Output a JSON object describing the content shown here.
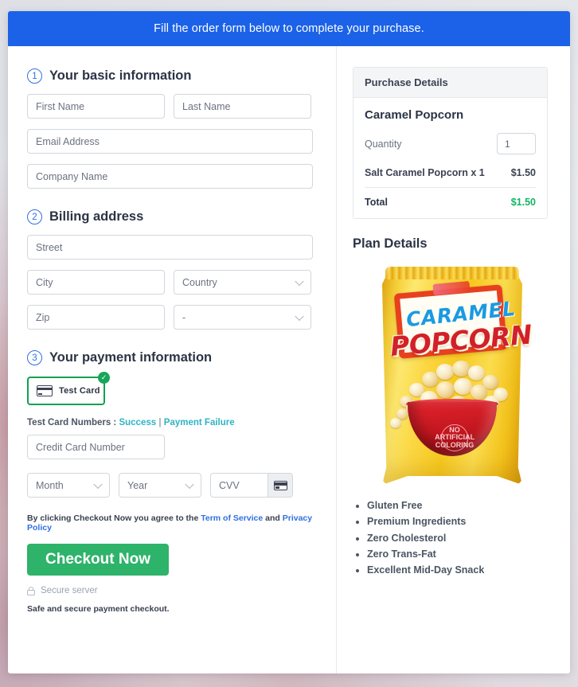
{
  "banner": {
    "text": "Fill the order form below to complete your purchase."
  },
  "steps": {
    "one": {
      "num": "1",
      "title": "Your basic information"
    },
    "two": {
      "num": "2",
      "title": "Billing address"
    },
    "three": {
      "num": "3",
      "title": "Your payment information"
    }
  },
  "basic": {
    "first_name_placeholder": "First Name",
    "last_name_placeholder": "Last Name",
    "email_placeholder": "Email Address",
    "company_placeholder": "Company Name"
  },
  "billing": {
    "street_placeholder": "Street",
    "city_placeholder": "City",
    "country_placeholder": "Country",
    "zip_placeholder": "Zip",
    "state_placeholder": "-"
  },
  "payment": {
    "test_card_label": "Test Card",
    "selected_badge": "✓",
    "test_numbers_label": "Test Card Numbers :",
    "success_link": "Success",
    "separator": "|",
    "failure_link": "Payment Failure",
    "card_number_placeholder": "Credit Card Number",
    "month_placeholder": "Month",
    "year_placeholder": "Year",
    "cvv_placeholder": "CVV"
  },
  "terms": {
    "prefix": "By clicking Checkout Now you agree to the",
    "tos_link": "Term of Service",
    "and": "and",
    "privacy_link": "Privacy Policy"
  },
  "checkout": {
    "button_label": "Checkout Now",
    "secure_label": "Secure server",
    "safe_note": "Safe and secure payment checkout."
  },
  "purchase": {
    "panel_title": "Purchase Details",
    "product_name": "Caramel Popcorn",
    "quantity_label": "Quantity",
    "quantity_value": "1",
    "line_item_label": "Salt Caramel Popcorn x 1",
    "line_item_price": "$1.50",
    "total_label": "Total",
    "total_price": "$1.50"
  },
  "plan": {
    "title": "Plan Details",
    "product_image": {
      "brand_top": "CARAMEL",
      "brand_main": "POPCORN",
      "seal_text": "NO ARTIFICIAL COLORING"
    },
    "features": [
      "Gluten Free",
      "Premium Ingredients",
      "Zero Cholesterol",
      "Zero Trans-Fat",
      "Excellent Mid-Day Snack"
    ]
  },
  "colors": {
    "banner_blue": "#1b62e8",
    "accent_green": "#2eb36a",
    "total_green": "#10b665",
    "link_teal": "#2fb3c4",
    "link_blue": "#2f6fe0",
    "selected_border": "#12a150"
  }
}
